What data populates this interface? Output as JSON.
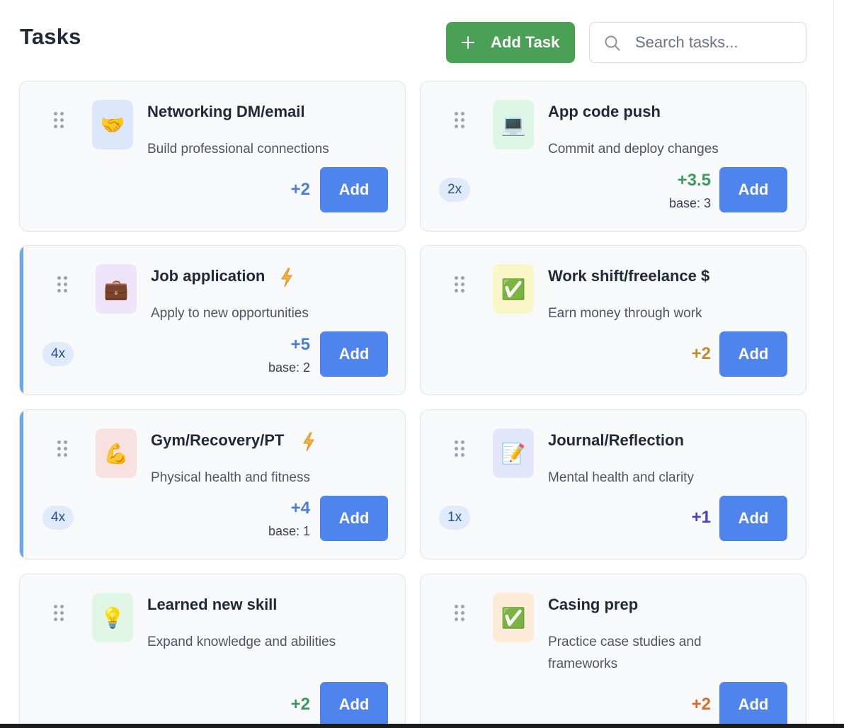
{
  "header": {
    "title": "Tasks",
    "add_task_label": "Add Task",
    "search_placeholder": "Search tasks..."
  },
  "colors": {
    "green": "#4aa156",
    "blue": "#4f84ec",
    "points_blue": "#4a7fd6",
    "points_green": "#3e9a5f",
    "points_gold": "#c08a2d",
    "points_purple": "#4b3fce",
    "points_orange": "#dd6a2b"
  },
  "tasks": [
    {
      "title": "Networking DM/email",
      "description": "Build professional connections",
      "icon": "handshake-icon",
      "emoji": "🤝",
      "points": "+2",
      "add_label": "Add"
    },
    {
      "title": "App code push",
      "description": "Commit and deploy changes",
      "icon": "laptop-icon",
      "emoji": "💻",
      "multiplier": "2x",
      "points": "+3.5",
      "base": "base: 3",
      "add_label": "Add"
    },
    {
      "title": "Job application",
      "description": "Apply to new opportunities",
      "icon": "briefcase-icon",
      "emoji": "💼",
      "multiplier": "4x",
      "points": "+5",
      "base": "base: 2",
      "add_label": "Add"
    },
    {
      "title": "Work shift/freelance $",
      "description": "Earn money through work",
      "icon": "check-icon",
      "emoji": "✅",
      "points": "+2",
      "add_label": "Add"
    },
    {
      "title": "Gym/Recovery/PT",
      "description": "Physical health and fitness",
      "icon": "flexed-biceps-icon",
      "emoji": "💪",
      "multiplier": "4x",
      "points": "+4",
      "base": "base: 1",
      "add_label": "Add"
    },
    {
      "title": "Journal/Reflection",
      "description": "Mental health and clarity",
      "icon": "memo-icon",
      "emoji": "📝",
      "multiplier": "1x",
      "points": "+1",
      "add_label": "Add"
    },
    {
      "title": "Learned new skill",
      "description": "Expand knowledge and abilities",
      "icon": "lightbulb-icon",
      "emoji": "💡",
      "points": "+2",
      "add_label": "Add"
    },
    {
      "title": "Casing prep",
      "description_line1": "Practice case studies and",
      "description_line2": "frameworks",
      "icon": "check-icon",
      "emoji": "✅",
      "points": "+2",
      "add_label": "Add"
    }
  ]
}
